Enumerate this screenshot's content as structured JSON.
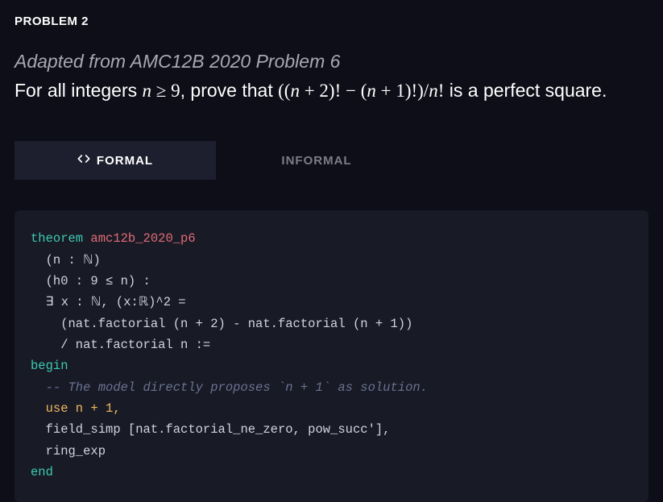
{
  "header": {
    "label": "PROBLEM 2"
  },
  "statement": {
    "adapted": "Adapted from AMC12B 2020 Problem 6",
    "prefix": "For all integers ",
    "cond_var": "n",
    "cond_op": " ≥ 9",
    "mid": ", prove that ",
    "expr": "((n + 2)! − (n + 1)!)/n!",
    "suffix": " is a perfect square."
  },
  "tabs": {
    "formal": "FORMAL",
    "informal": "INFORMAL"
  },
  "code": {
    "kw_theorem": "theorem",
    "thm_name": " amc12b_2020_p6",
    "line2": "  (n : ℕ)",
    "line3": "  (h0 : 9 ≤ n) :",
    "line4": "  ∃ x : ℕ, (x:ℝ)^2 =",
    "line5": "    (nat.factorial (n + 2) - nat.factorial (n + 1))",
    "line6": "    / nat.factorial n :=",
    "kw_begin": "begin",
    "comment": "  -- The model directly proposes `n + 1` as solution.",
    "use_line": "  use n + 1,",
    "line_fs": "  field_simp [nat.factorial_ne_zero, pow_succ'],",
    "line_re": "  ring_exp",
    "kw_end": "end"
  }
}
